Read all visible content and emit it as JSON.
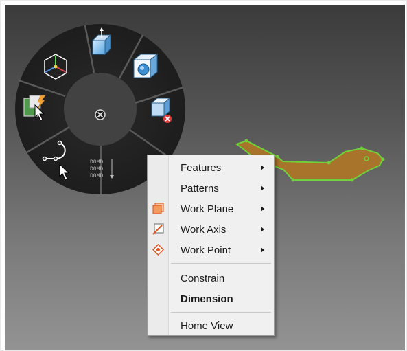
{
  "context_menu": {
    "items": [
      {
        "label": "Features",
        "submenu": true,
        "icon": null
      },
      {
        "label": "Patterns",
        "submenu": true,
        "icon": null
      },
      {
        "label": "Work Plane",
        "submenu": true,
        "icon": "work-plane-icon"
      },
      {
        "label": "Work Axis",
        "submenu": true,
        "icon": "work-axis-icon"
      },
      {
        "label": "Work Point",
        "submenu": true,
        "icon": "work-point-icon"
      },
      {
        "label": "Constrain",
        "submenu": false,
        "icon": null
      },
      {
        "label": "Dimension",
        "submenu": false,
        "icon": null,
        "bold": true
      },
      {
        "label": "Home View",
        "submenu": false,
        "icon": null
      }
    ]
  },
  "marking_menu": {
    "center": "close-icon",
    "wedges": [
      "extrude-icon",
      "revolve-icon",
      "delete-face-icon",
      "dimension-list-icon",
      "line-spline-icon",
      "finish-sketch-icon",
      "origin-axes-icon"
    ],
    "dimension_list_text": [
      "D0MD",
      "D0MD",
      "D0MD"
    ]
  },
  "colors": {
    "sketch_fill": "#a8732a",
    "sketch_outline": "#6fd23a",
    "accent_orange": "#e86a1f"
  }
}
